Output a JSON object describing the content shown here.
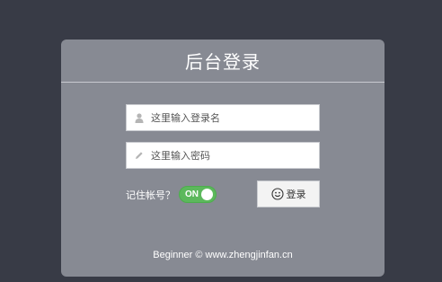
{
  "login": {
    "title": "后台登录",
    "username_placeholder": "这里输入登录名",
    "password_placeholder": "这里输入密码",
    "remember_label": "记住帐号？",
    "remember_toggle": "ON",
    "remember_on": true,
    "submit_label": "登录",
    "footer": "Beginner © www.zhengjinfan.cn"
  },
  "icons": {
    "username_icon": "user-icon",
    "password_icon": "pencil-icon",
    "submit_icon": "smile-icon"
  },
  "colors": {
    "page_background": "#383b46",
    "panel_background": "#878a93",
    "toggle_on": "#5cb85c"
  }
}
